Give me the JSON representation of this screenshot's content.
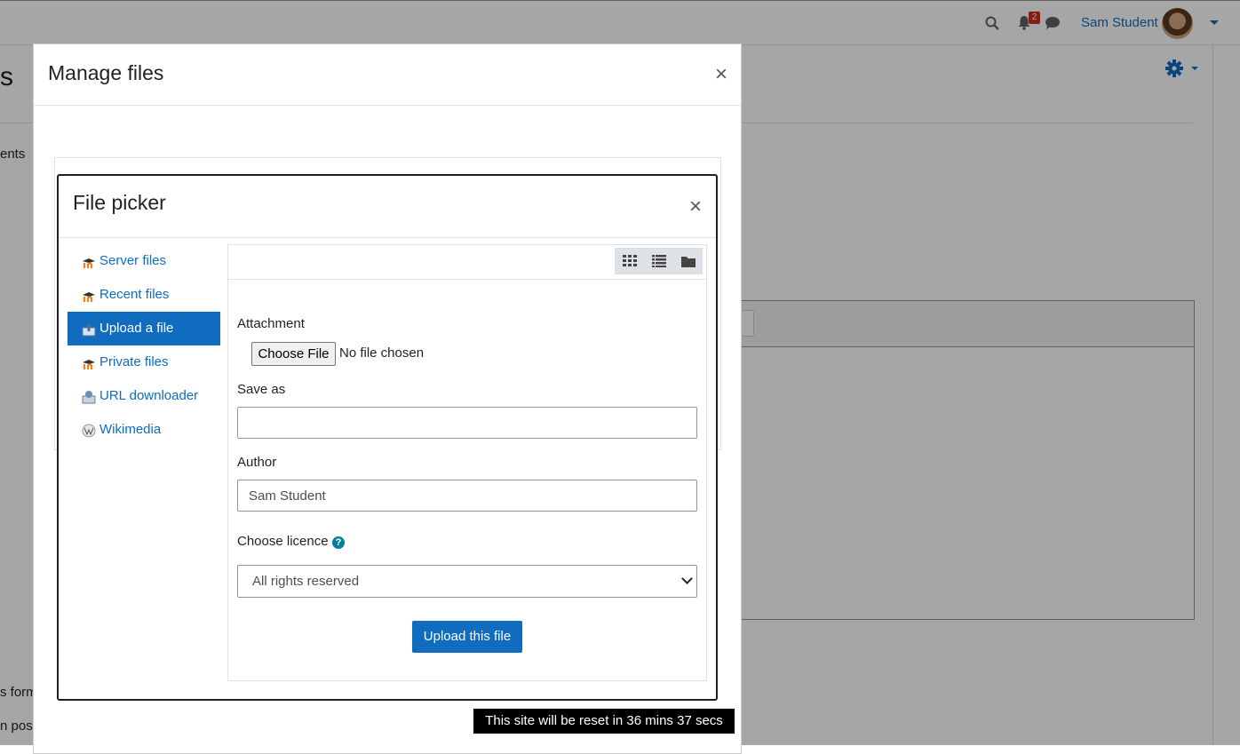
{
  "navbar": {
    "user_name": "Sam Student",
    "notification_count": "2",
    "icons": [
      "search-icon",
      "bell-icon",
      "chat-icon",
      "chevron-down-icon"
    ]
  },
  "background": {
    "title_fragment": "s",
    "fragment_1": "ents",
    "fragment_2": "s form",
    "fragment_3": "n post"
  },
  "manage_files": {
    "title": "Manage files",
    "close_label": "×"
  },
  "file_picker": {
    "title": "File picker",
    "close_label": "×",
    "repositories": [
      {
        "label": "Server files",
        "icon": "moodle-icon"
      },
      {
        "label": "Recent files",
        "icon": "moodle-icon"
      },
      {
        "label": "Upload a file",
        "icon": "upload-icon",
        "active": true
      },
      {
        "label": "Private files",
        "icon": "moodle-icon"
      },
      {
        "label": "URL downloader",
        "icon": "url-download-icon"
      },
      {
        "label": "Wikimedia",
        "icon": "wikimedia-icon"
      }
    ],
    "view_buttons": [
      "grid-view-icon",
      "list-view-icon",
      "folder-view-icon"
    ],
    "form": {
      "attachment_label": "Attachment",
      "choose_file_label": "Choose File",
      "no_file_text": "No file chosen",
      "save_as_label": "Save as",
      "save_as_value": "",
      "author_label": "Author",
      "author_value": "Sam Student",
      "licence_label": "Choose licence",
      "licence_value": "All rights reserved",
      "upload_button": "Upload this file"
    }
  },
  "reset_banner": "This site will be reset in 36 mins 37 secs",
  "colors": {
    "accent": "#0f6cbf",
    "badge": "#ca3120",
    "help": "#008196"
  }
}
